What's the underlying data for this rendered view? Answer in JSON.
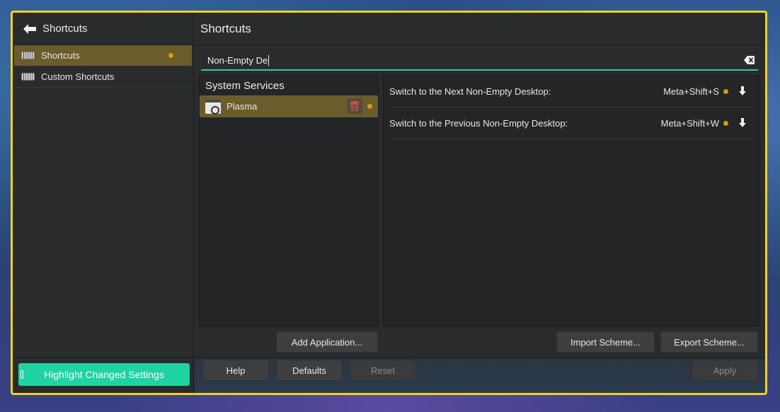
{
  "sidebar": {
    "header": "Shortcuts",
    "items": [
      {
        "label": "Shortcuts",
        "selected": true,
        "changed": true
      },
      {
        "label": "Custom Shortcuts",
        "selected": false,
        "changed": false
      }
    ],
    "highlight_button": "Highlight Changed Settings"
  },
  "main": {
    "title": "Shortcuts",
    "search": {
      "value": "Non-Empty De"
    },
    "left_panel": {
      "title": "System Services",
      "items": [
        {
          "label": "Plasma",
          "changed": true
        }
      ]
    },
    "shortcuts": [
      {
        "action": "Switch to the Next Non-Empty Desktop:",
        "keys": "Meta+Shift+S"
      },
      {
        "action": "Switch to the Previous Non-Empty Desktop:",
        "keys": "Meta+Shift+W"
      }
    ],
    "buttons": {
      "add_application": "Add Application...",
      "import_scheme": "Import Scheme...",
      "export_scheme": "Export Scheme..."
    }
  },
  "footer": {
    "help": "Help",
    "defaults": "Defaults",
    "reset": "Reset",
    "apply": "Apply"
  },
  "colors": {
    "accent": "#1fd3a2",
    "selection": "#6b5c2b",
    "changed_dot": "#d09a1c",
    "window_border": "#f2d21a"
  },
  "icons": [
    "back-arrow-icon",
    "keyboard-icon",
    "clear-text-icon",
    "application-icon",
    "trash-icon",
    "download-arrow-icon",
    "info-icon"
  ]
}
